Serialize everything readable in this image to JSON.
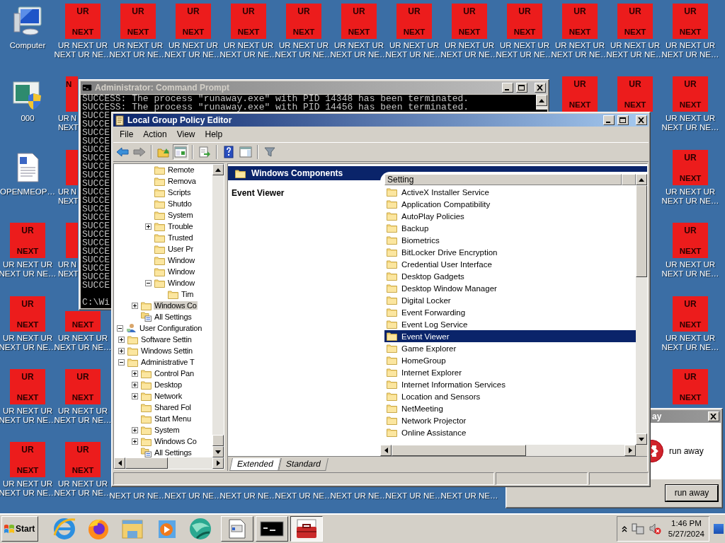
{
  "desktop": {
    "rows": [
      [
        {
          "kind": "computer",
          "label": [
            "Computer"
          ]
        },
        {
          "kind": "tile",
          "top": "UR",
          "bottom": "NEXT",
          "label": [
            "UR NEXT UR",
            "NEXT UR NE…"
          ]
        },
        {
          "kind": "tile",
          "top": "UR",
          "bottom": "NEXT",
          "label": [
            "UR NEXT UR",
            "NEXT UR NE…"
          ]
        },
        {
          "kind": "tile",
          "top": "UR",
          "bottom": "NEXT",
          "label": [
            "UR NEXT UR",
            "NEXT UR NE…"
          ]
        },
        {
          "kind": "tile",
          "top": "UR",
          "bottom": "NEXT",
          "label": [
            "UR NEXT UR",
            "NEXT UR NE…"
          ]
        },
        {
          "kind": "tile",
          "top": "UR",
          "bottom": "NEXT",
          "label": [
            "UR NEXT UR",
            "NEXT UR NE…"
          ]
        },
        {
          "kind": "tile",
          "top": "UR",
          "bottom": "NEXT",
          "label": [
            "UR NEXT UR",
            "NEXT UR NE…"
          ]
        },
        {
          "kind": "tile",
          "top": "UR",
          "bottom": "NEXT",
          "label": [
            "UR NEXT UR",
            "NEXT UR NE…"
          ]
        },
        {
          "kind": "tile",
          "top": "UR",
          "bottom": "NEXT",
          "label": [
            "UR NEXT UR",
            "NEXT UR NE…"
          ]
        },
        {
          "kind": "tile",
          "top": "UR",
          "bottom": "NEXT",
          "label": [
            "UR NEXT UR",
            "NEXT UR NE…"
          ]
        },
        {
          "kind": "tile",
          "top": "UR",
          "bottom": "NEXT",
          "label": [
            "UR NEXT UR",
            "NEXT UR NE…"
          ]
        },
        {
          "kind": "tile",
          "top": "UR",
          "bottom": "NEXT",
          "label": [
            "UR NEXT UR",
            "NEXT UR NE…"
          ]
        },
        {
          "kind": "tile",
          "top": "UR",
          "bottom": "NEXT",
          "label": [
            "UR NEXT UR",
            "NEXT UR NE…"
          ]
        }
      ],
      [
        {
          "kind": "app",
          "label": [
            "000"
          ]
        },
        {
          "kind": "clipped",
          "bottom": "N",
          "label": [
            "UR N",
            "NEXT"
          ]
        },
        {
          "kind": "covered"
        },
        {
          "kind": "covered"
        },
        {
          "kind": "covered"
        },
        {
          "kind": "covered"
        },
        {
          "kind": "covered"
        },
        {
          "kind": "covered"
        },
        {
          "kind": "covered"
        },
        {
          "kind": "covered"
        },
        {
          "kind": "tile",
          "top": "UR",
          "bottom": "NEXT"
        },
        {
          "kind": "tile",
          "top": "UR",
          "bottom": "NEXT"
        },
        {
          "kind": "tile",
          "top": "UR",
          "bottom": "NEXT",
          "label": [
            "UR NEXT UR",
            "NEXT UR NE…"
          ]
        }
      ],
      [
        {
          "kind": "document",
          "label": [
            "OPENMEOP…"
          ]
        },
        {
          "kind": "clipped",
          "label": [
            "UR N",
            "NEXT"
          ]
        },
        {
          "kind": "covered"
        },
        {
          "kind": "covered"
        },
        {
          "kind": "covered"
        },
        {
          "kind": "covered"
        },
        {
          "kind": "covered"
        },
        {
          "kind": "covered"
        },
        {
          "kind": "covered"
        },
        {
          "kind": "covered"
        },
        {
          "kind": "covered"
        },
        {
          "kind": "covered"
        },
        {
          "kind": "tile",
          "top": "UR",
          "bottom": "NEXT",
          "label": [
            "UR NEXT UR",
            "NEXT UR NE…"
          ]
        }
      ],
      [
        {
          "kind": "tile",
          "top": "UR",
          "bottom": "NEXT",
          "label": [
            "UR NEXT UR",
            "NEXT UR NE…"
          ]
        },
        {
          "kind": "clipped",
          "label": [
            "UR N",
            "NEXT"
          ]
        },
        {
          "kind": "covered"
        },
        {
          "kind": "covered"
        },
        {
          "kind": "covered"
        },
        {
          "kind": "covered"
        },
        {
          "kind": "covered"
        },
        {
          "kind": "covered"
        },
        {
          "kind": "covered"
        },
        {
          "kind": "covered"
        },
        {
          "kind": "covered"
        },
        {
          "kind": "covered"
        },
        {
          "kind": "tile",
          "top": "UR",
          "bottom": "NEXT",
          "label": [
            "UR NEXT UR",
            "NEXT UR NE…"
          ]
        }
      ],
      [
        {
          "kind": "tile",
          "top": "UR",
          "bottom": "NEXT",
          "label": [
            "UR NEXT UR",
            "NEXT UR NE…"
          ]
        },
        {
          "kind": "lower",
          "bottom": "NEXT",
          "label": [
            "UR NEXT UR",
            "NEXT UR NE…"
          ]
        },
        {
          "kind": "covered"
        },
        {
          "kind": "covered"
        },
        {
          "kind": "covered"
        },
        {
          "kind": "covered"
        },
        {
          "kind": "covered"
        },
        {
          "kind": "covered"
        },
        {
          "kind": "covered"
        },
        {
          "kind": "covered"
        },
        {
          "kind": "covered"
        },
        {
          "kind": "covered"
        },
        {
          "kind": "tile",
          "top": "UR",
          "bottom": "NEXT",
          "label": [
            "UR NEXT UR",
            "NEXT UR NE…"
          ]
        }
      ],
      [
        {
          "kind": "tile",
          "top": "UR",
          "bottom": "NEXT",
          "label": [
            "UR NEXT UR",
            "NEXT UR NE…"
          ]
        },
        {
          "kind": "tile",
          "top": "UR",
          "bottom": "NEXT",
          "label": [
            "UR NEXT UR",
            "NEXT UR NE…"
          ]
        },
        {
          "kind": "covered"
        },
        {
          "kind": "covered"
        },
        {
          "kind": "covered"
        },
        {
          "kind": "covered"
        },
        {
          "kind": "covered"
        },
        {
          "kind": "covered"
        },
        {
          "kind": "covered"
        },
        {
          "kind": "covered"
        },
        {
          "kind": "covered"
        },
        {
          "kind": "covered"
        },
        {
          "kind": "tile",
          "top": "UR",
          "bottom": "NEXT"
        }
      ],
      [
        {
          "kind": "tile",
          "top": "UR",
          "bottom": "NEXT",
          "label": [
            "UR NEXT UR",
            "NEXT UR NE…"
          ]
        },
        {
          "kind": "tile",
          "top": "UR",
          "bottom": "NEXT",
          "label": [
            "UR NEXT UR",
            "NEXT UR NE…"
          ]
        },
        {
          "kind": "tail",
          "label": [
            "NEXT UR NE…"
          ]
        },
        {
          "kind": "tail",
          "label": [
            "NEXT UR NE…"
          ]
        },
        {
          "kind": "tail",
          "label": [
            "NEXT UR NE…"
          ]
        },
        {
          "kind": "tail",
          "label": [
            "NEXT UR NE…"
          ]
        },
        {
          "kind": "tail",
          "label": [
            "NEXT UR NE…"
          ]
        },
        {
          "kind": "tail",
          "label": [
            "NEXT UR NE…"
          ]
        },
        {
          "kind": "tail",
          "label": [
            "NEXT UR NE…"
          ]
        },
        {
          "kind": "covered"
        },
        {
          "kind": "covered"
        },
        {
          "kind": "covered"
        },
        {
          "kind": "covered"
        }
      ]
    ]
  },
  "command_prompt": {
    "title": "Administrator:  Command Prompt",
    "lines": [
      "SUCCESS: The process \"runaway.exe\" with PID 14348 has been terminated.",
      "SUCCESS: The process \"runaway.exe\" with PID 14456 has been terminated.",
      "SUCCE",
      "SUCCE",
      "SUCCE",
      "SUCCE",
      "SUCCE",
      "SUCCE",
      "SUCCE",
      "SUCCE",
      "SUCCE",
      "SUCCE",
      "SUCCE",
      "SUCCE",
      "SUCCE",
      "SUCCE",
      "SUCCE",
      "SUCCE",
      "SUCCE",
      "SUCCE",
      "SUCCE",
      "SUCCE",
      "SUCCE"
    ],
    "prompt": "C:\\Wi"
  },
  "group_policy_editor": {
    "title": "Local Group Policy Editor",
    "menu": [
      "File",
      "Action",
      "View",
      "Help"
    ],
    "tree": [
      {
        "children": [
          {
            "children": [
              {
                "children": [
                  {
                    "label": "Remote",
                    "selected": false
                  },
                  {
                    "label": "Remova",
                    "selected": false
                  },
                  {
                    "label": "Scripts",
                    "selected": false
                  },
                  {
                    "label": "Shutdo",
                    "selected": false
                  },
                  {
                    "label": "System",
                    "selected": false
                  },
                  {
                    "label": "Trouble",
                    "selected": false,
                    "expanded": false
                  },
                  {
                    "label": "Trusted",
                    "selected": false
                  },
                  {
                    "label": "User Pr",
                    "selected": false
                  },
                  {
                    "label": "Window",
                    "selected": false
                  },
                  {
                    "label": "Window",
                    "selected": false
                  },
                  {
                    "label": "Window",
                    "selected": false,
                    "expanded": true,
                    "children": [
                      {
                        "label": "Tim",
                        "selected": false
                      }
                    ]
                  }
                ]
              },
              {
                "label": "Windows Co",
                "selected": true,
                "expanded": false
              },
              {
                "label": "All Settings",
                "kind": "settings",
                "selected": false
              }
            ]
          }
        ]
      },
      {
        "label": "User Configuration",
        "kind": "user",
        "selected": false,
        "expanded": true,
        "children": [
          {
            "label": "Software Settin",
            "selected": false,
            "expanded": false
          },
          {
            "label": "Windows Settin",
            "selected": false,
            "expanded": false
          },
          {
            "label": "Administrative T",
            "selected": false,
            "expanded": true,
            "children": [
              {
                "label": "Control Pan",
                "selected": false,
                "expanded": false
              },
              {
                "label": "Desktop",
                "selected": false,
                "expanded": false
              },
              {
                "label": "Network",
                "selected": false,
                "expanded": false
              },
              {
                "label": "Shared Fol",
                "selected": false
              },
              {
                "label": "Start Menu",
                "selected": false
              },
              {
                "label": "System",
                "selected": false,
                "expanded": false
              },
              {
                "label": "Windows Co",
                "selected": false,
                "expanded": false
              },
              {
                "label": "All Settings",
                "kind": "settings",
                "selected": false
              }
            ]
          }
        ]
      }
    ],
    "header": "Windows Components",
    "description_title": "Event Viewer",
    "list": {
      "column": "Setting",
      "items": [
        {
          "label": "ActiveX Installer Service",
          "selected": false
        },
        {
          "label": "Application Compatibility",
          "selected": false
        },
        {
          "label": "AutoPlay Policies",
          "selected": false
        },
        {
          "label": "Backup",
          "selected": false
        },
        {
          "label": "Biometrics",
          "selected": false
        },
        {
          "label": "BitLocker Drive Encryption",
          "selected": false
        },
        {
          "label": "Credential User Interface",
          "selected": false
        },
        {
          "label": "Desktop Gadgets",
          "selected": false
        },
        {
          "label": "Desktop Window Manager",
          "selected": false
        },
        {
          "label": "Digital Locker",
          "selected": false
        },
        {
          "label": "Event Forwarding",
          "selected": false
        },
        {
          "label": "Event Log Service",
          "selected": false
        },
        {
          "label": "Event Viewer",
          "selected": true
        },
        {
          "label": "Game Explorer",
          "selected": false
        },
        {
          "label": "HomeGroup",
          "selected": false
        },
        {
          "label": "Internet Explorer",
          "selected": false
        },
        {
          "label": "Internet Information Services",
          "selected": false
        },
        {
          "label": "Location and Sensors",
          "selected": false
        },
        {
          "label": "NetMeeting",
          "selected": false
        },
        {
          "label": "Network Projector",
          "selected": false
        },
        {
          "label": "Online Assistance",
          "selected": false
        }
      ]
    },
    "tabs": [
      {
        "label": "Extended",
        "selected": true
      },
      {
        "label": "Standard",
        "selected": false
      }
    ]
  },
  "dialog": {
    "title": "ay",
    "message": "run away",
    "button": "run away"
  },
  "taskbar": {
    "start": "Start",
    "tasks": [
      {
        "selected": false
      },
      {
        "selected": false
      },
      {
        "selected": true
      }
    ],
    "clock": {
      "time": "1:46 PM",
      "date": "5/27/2024"
    }
  }
}
